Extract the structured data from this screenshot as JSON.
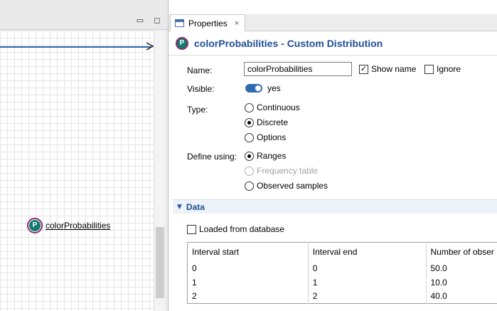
{
  "canvas": {
    "element_label": "colorProbabilities",
    "element_icon_letter": "P"
  },
  "properties": {
    "tab_label": "Properties",
    "tab_close": "×",
    "header_title": "colorProbabilities - Custom Distribution",
    "name_label": "Name:",
    "name_value": "colorProbabilities",
    "show_name_label": "Show name",
    "show_name_checked": true,
    "ignore_label": "Ignore",
    "ignore_checked": false,
    "visible_label": "Visible:",
    "visible_value": "yes",
    "type_label": "Type:",
    "type_options": [
      "Continuous",
      "Discrete",
      "Options"
    ],
    "type_selected": "Discrete",
    "define_label": "Define using:",
    "define_options": [
      "Ranges",
      "Frequency table",
      "Observed samples"
    ],
    "define_selected": "Ranges",
    "define_disabled": "Frequency table",
    "data_section_title": "Data",
    "loaded_from_db_label": "Loaded from database",
    "loaded_from_db_checked": false,
    "table": {
      "headers": [
        "Interval start",
        "Interval end",
        "Number of obser"
      ],
      "rows": [
        [
          "0",
          "0",
          "50.0"
        ],
        [
          "1",
          "1",
          "10.0"
        ],
        [
          "2",
          "2",
          "40.0"
        ]
      ]
    }
  },
  "colors": {
    "title_blue": "#1f4e96",
    "toggle_blue": "#2f6bb3",
    "icon_teal": "#137a72",
    "icon_ring": "#8a2d6b"
  }
}
